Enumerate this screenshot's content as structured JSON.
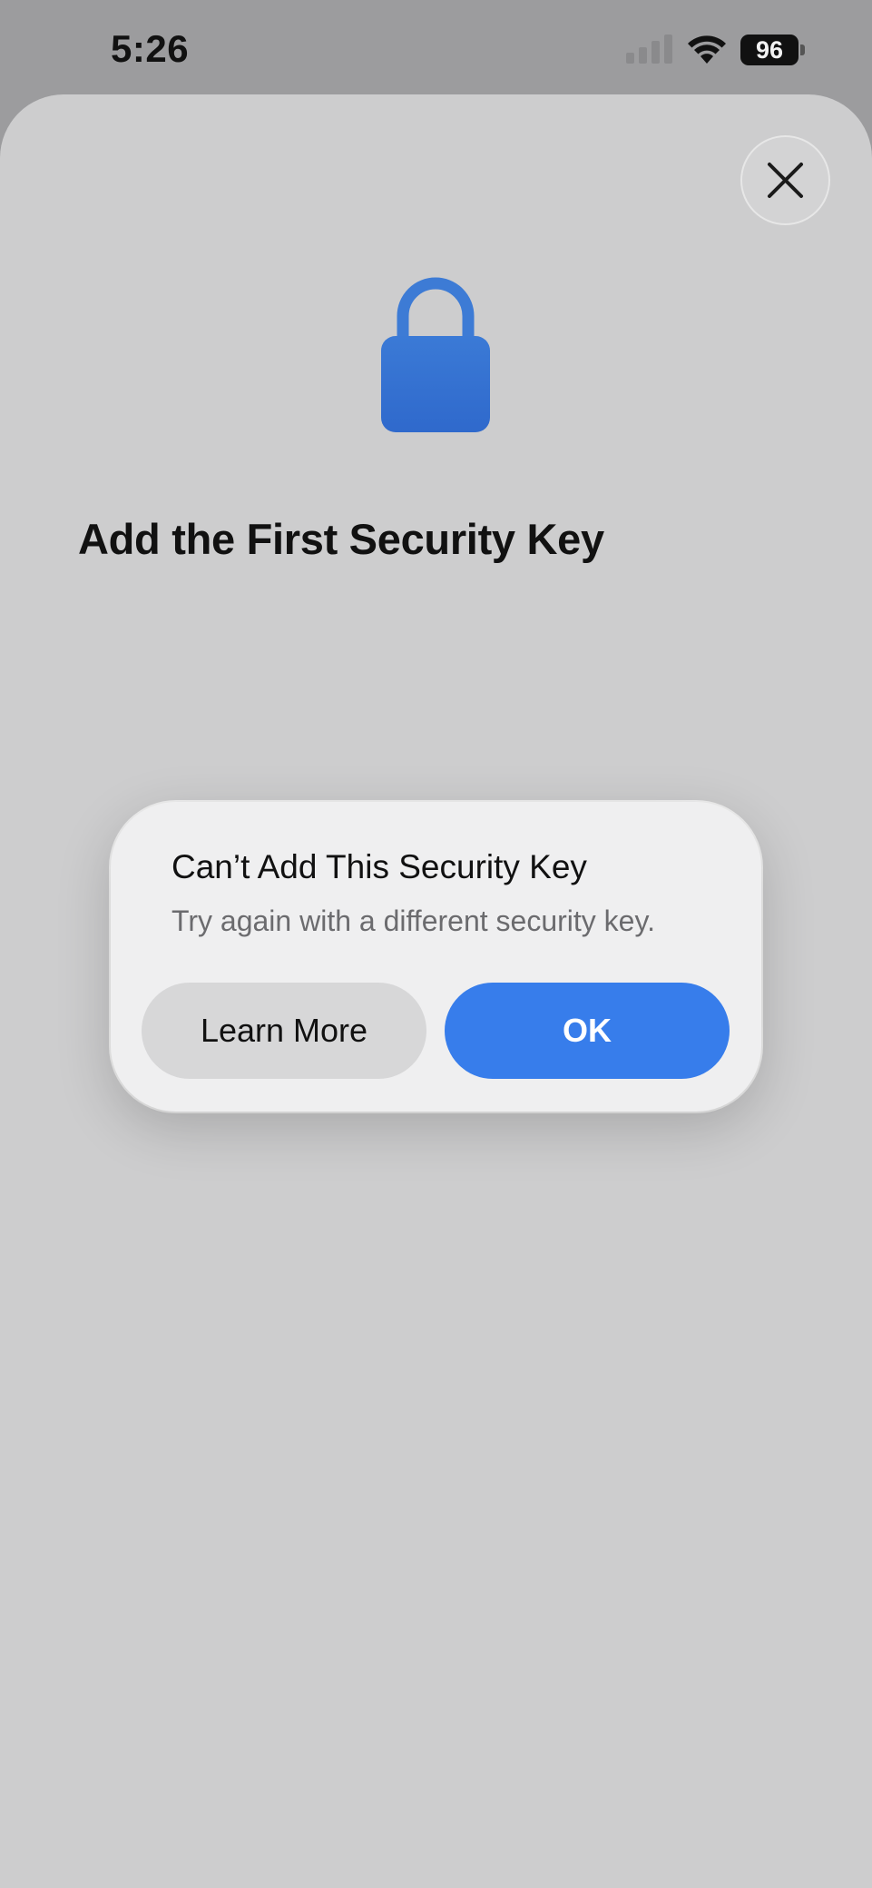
{
  "status_bar": {
    "time": "5:26",
    "battery_level": "96",
    "icons": [
      "signal-icon",
      "wifi-icon",
      "battery-icon"
    ]
  },
  "sheet": {
    "close_icon": "close-icon",
    "hero_icon": "lock-icon",
    "title": "Add the First Security Key"
  },
  "alert": {
    "title": "Can’t Add This Security Key",
    "message": "Try again with a different security key.",
    "secondary_button": "Learn More",
    "primary_button": "OK"
  },
  "colors": {
    "accent": "#377deb",
    "lock": "#3472d4",
    "sheet_background": "#cdcdce",
    "alert_background": "#efeff0"
  }
}
